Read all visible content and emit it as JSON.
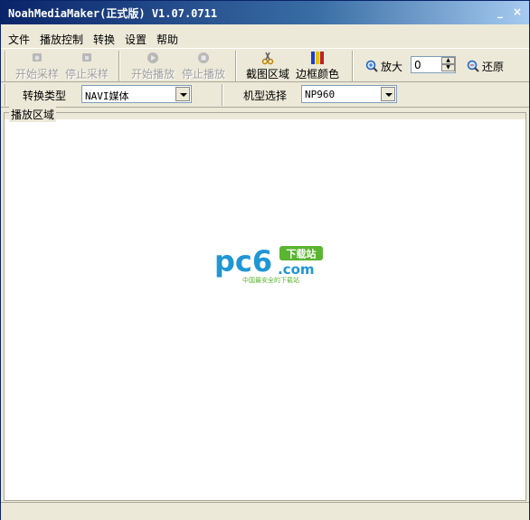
{
  "window": {
    "title": "NoahMediaMaker(正式版) V1.07.0711",
    "minimize_glyph": "_",
    "close_glyph": "×"
  },
  "menu": [
    "文件",
    "播放控制",
    "转换",
    "设置",
    "帮助"
  ],
  "toolbar": {
    "start_capture": "开始采样",
    "stop_capture": "停止采样",
    "start_play": "开始播放",
    "stop_play": "停止播放",
    "capture_region": "截图区域",
    "border_color": "边框颜色",
    "zoom_in": "放大",
    "zoom_value": "0",
    "restore": "还原"
  },
  "row2": {
    "convert_type_label": "转换类型",
    "convert_type_value": "NAVI媒体",
    "model_label": "机型选择",
    "model_value": "NP960"
  },
  "play_area": {
    "label": "播放区域"
  },
  "watermark": {
    "brand": "pc6",
    "domain": ".com",
    "badge": "下载站",
    "slogan": "中国最安全的下载站",
    "colors": {
      "primary": "#1f97d4",
      "accent": "#5bb531"
    }
  }
}
